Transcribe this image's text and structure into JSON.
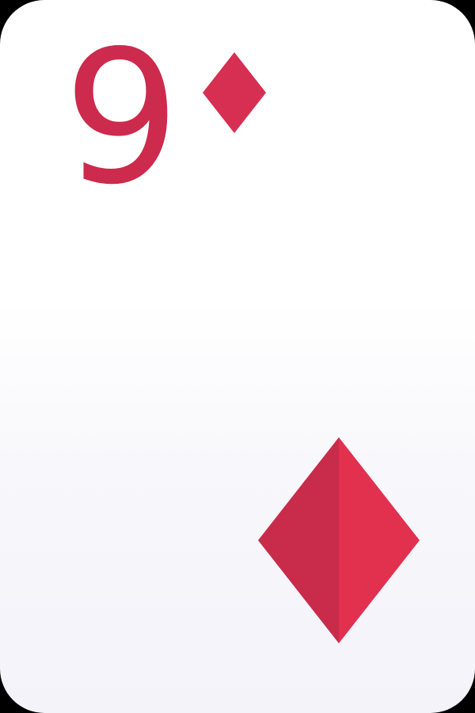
{
  "card": {
    "rank": "9",
    "suit": "diamonds",
    "suit_icon": "diamond-icon"
  },
  "colors": {
    "card_background": "#ffffff",
    "card_background_bottom": "#f3f3f9",
    "rank_color": "#cc2b4d",
    "suit_color": "#d72f51",
    "suit_shade_light": "#e2304f",
    "suit_shade_dark": "#c92c4b",
    "outer_background": "#000000"
  }
}
